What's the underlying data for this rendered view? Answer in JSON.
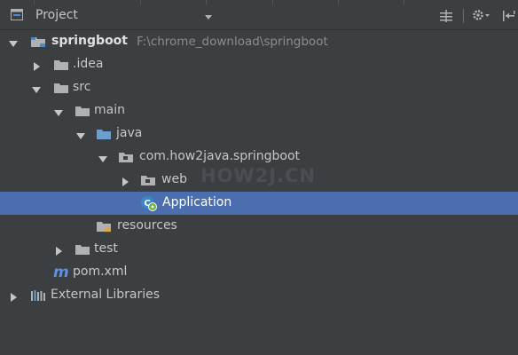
{
  "panel": {
    "title": "Project",
    "icons": {
      "panel": "project-view-icon",
      "dropdown": "chevron-down-icon",
      "collapse": "collapse-all-icon",
      "settings": "gear-icon",
      "hide": "hide-panel-icon"
    }
  },
  "tree": {
    "project_name": "springboot",
    "project_path": "F:\\chrome_download\\springboot",
    "items": [
      {
        "label": "springboot",
        "icon": "module-folder-icon",
        "expanded": true
      },
      {
        "label": ".idea",
        "icon": "folder-icon",
        "expanded": false
      },
      {
        "label": "src",
        "icon": "folder-icon",
        "expanded": true
      },
      {
        "label": "main",
        "icon": "folder-icon",
        "expanded": true
      },
      {
        "label": "java",
        "icon": "source-root-folder-icon",
        "expanded": true
      },
      {
        "label": "com.how2java.springboot",
        "icon": "package-icon",
        "expanded": true
      },
      {
        "label": "web",
        "icon": "package-icon",
        "expanded": false
      },
      {
        "label": "Application",
        "icon": "spring-boot-class-icon",
        "selected": true
      },
      {
        "label": "resources",
        "icon": "resources-folder-icon"
      },
      {
        "label": "test",
        "icon": "folder-icon",
        "expanded": false
      },
      {
        "label": "pom.xml",
        "icon": "maven-icon"
      },
      {
        "label": "External Libraries",
        "icon": "libraries-icon",
        "expanded": false
      }
    ]
  },
  "watermark": "HOW2J.CN",
  "colors": {
    "background": "#3c3f41",
    "selection": "#4b6eaf",
    "text": "#c6c6c6",
    "folder": "#afb1b3",
    "source_root": "#6c9fcf",
    "maven": "#5c91e6"
  }
}
